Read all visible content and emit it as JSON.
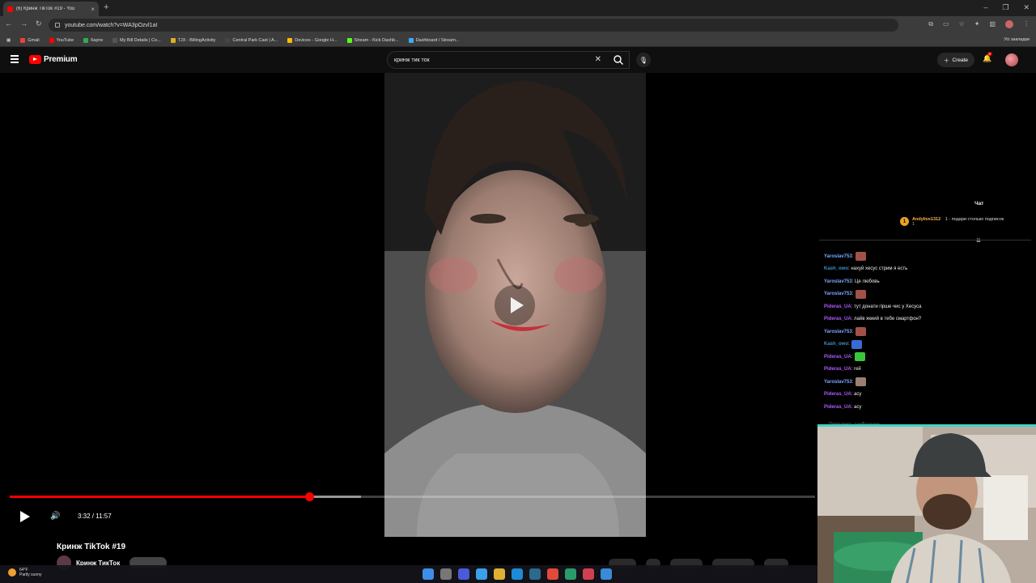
{
  "browser": {
    "tab_title": "(6) Кринж TikTok #19 - You",
    "url": "youtube.com/watch?v=WA3pOzvl1aI",
    "bookmarks": [
      {
        "label": "Gmail",
        "color": "#ea4335"
      },
      {
        "label": "YouTube",
        "color": "#ff0000"
      },
      {
        "label": "Карти",
        "color": "#34a853"
      },
      {
        "label": "My Bill Details | Co...",
        "color": "#555555"
      },
      {
        "label": "TJX - BillingActivity",
        "color": "#e0b020"
      },
      {
        "label": "Central Park Cast | A...",
        "color": "#444444"
      },
      {
        "label": "Devices - Google H...",
        "color": "#fbbc05"
      },
      {
        "label": "Stream - Kick Dashb...",
        "color": "#53fc18"
      },
      {
        "label": "Dashboard / Stream...",
        "color": "#3fa9f5"
      }
    ],
    "bookmarks_right": "Усі закладки"
  },
  "youtube": {
    "logo_text": "Premium",
    "search_query": "кринж тик ток",
    "create_label": "Create",
    "notifications_count": "6",
    "video_title": "Кринж TikTok #19",
    "channel_name": "Кринж ТикТок",
    "time_display": "3:32 / 11:57",
    "progress_played": 0.372,
    "progress_loaded": 0.436
  },
  "chat": {
    "header": "Чат",
    "pinned": {
      "rank": "1",
      "user": "Andylive1312",
      "count": "1",
      "message": "1 - подари столько подписок"
    },
    "messages": [
      {
        "user": "Yaroslav753",
        "user_color": "#7aa7ff",
        "text": "",
        "emote": "#a0524a"
      },
      {
        "user": "Kash_owo",
        "user_color": "#3f8fc8",
        "text": "нахуй хесус стрим я есть",
        "emote": ""
      },
      {
        "user": "Yaroslav753",
        "user_color": "#7aa7ff",
        "text": "Це любовь",
        "emote": ""
      },
      {
        "user": "Yaroslav753",
        "user_color": "#7aa7ff",
        "text": "",
        "emote": "#a0524a"
      },
      {
        "user": "Pideras_UA",
        "user_color": "#b05cff",
        "text": "тут донати гірше чис у Хесуса",
        "emote": ""
      },
      {
        "user": "Pideras_UA",
        "user_color": "#b05cff",
        "text": "лайв якиий в тебе смартфон?",
        "emote": ""
      },
      {
        "user": "Yaroslav753",
        "user_color": "#7aa7ff",
        "text": "",
        "emote": "#a0524a"
      },
      {
        "user": "Kash_owo",
        "user_color": "#3f8fc8",
        "text": "",
        "emote": "#3b6ad6"
      },
      {
        "user": "Pideras_UA",
        "user_color": "#b05cff",
        "text": "",
        "emote": "#3cc43c"
      },
      {
        "user": "Pideras_UA",
        "user_color": "#b05cff",
        "text": "гей",
        "emote": ""
      },
      {
        "user": "Yaroslav753",
        "user_color": "#7aa7ff",
        "text": "",
        "emote": "#9a8070"
      },
      {
        "user": "Pideras_UA",
        "user_color": "#b05cff",
        "text": "асу",
        "emote": ""
      },
      {
        "user": "Pideras_UA",
        "user_color": "#b05cff",
        "text": "асу",
        "emote": ""
      }
    ],
    "input_placeholder": "Отправить сообщение"
  },
  "taskbar": {
    "temperature": "64°F",
    "weather": "Partly sunny",
    "icon_colors": [
      "#3d8ee8",
      "#777777",
      "#4a5ad8",
      "#3aa0e8",
      "#e0b030",
      "#1d8bd6",
      "#2a6a8a",
      "#e04a3a",
      "#2a9a6a",
      "#d04050",
      "#3a8ad8"
    ]
  }
}
